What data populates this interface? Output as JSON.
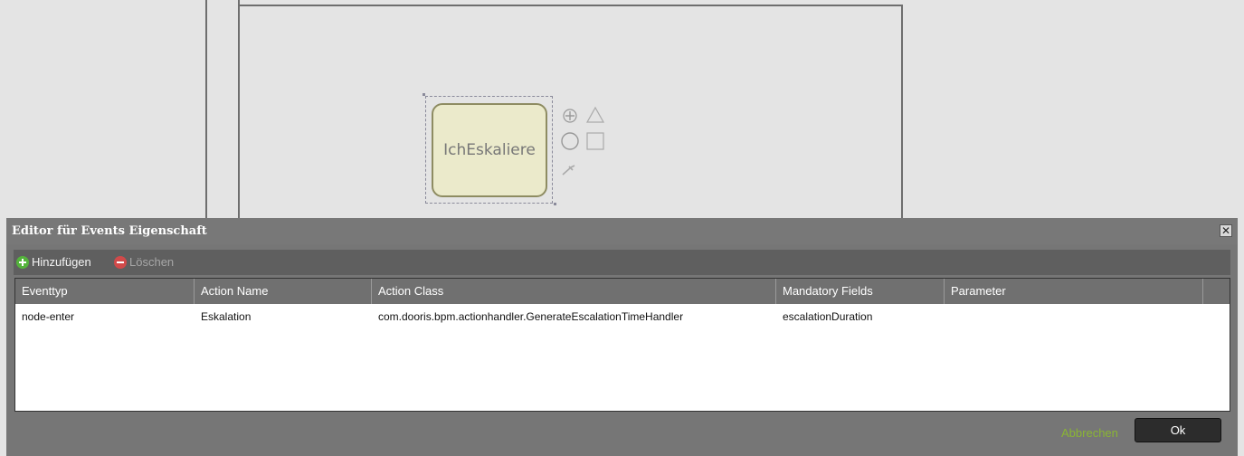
{
  "canvas": {
    "task_label": "IchEskaliere"
  },
  "dialog": {
    "title": "Editor für Events Eigenschaft",
    "close_symbol": "✕",
    "toolbar": {
      "add_label": "Hinzufügen",
      "delete_label": "Löschen"
    },
    "columns": [
      "Eventtyp",
      "Action Name",
      "Action Class",
      "Mandatory Fields",
      "Parameter"
    ],
    "rows": [
      {
        "eventtyp": "node-enter",
        "action_name": "Eskalation",
        "action_class": "com.dooris.bpm.actionhandler.GenerateEscalationTimeHandler",
        "mandatory_fields": "escalationDuration",
        "parameter": ""
      }
    ],
    "cancel_label": "Abbrechen",
    "ok_label": "Ok"
  },
  "colors": {
    "task_fill": "#ebeacb",
    "task_border": "#8e8c62",
    "dialog_bg": "#6e6e6e",
    "add_icon": "#54b33c",
    "delete_icon": "#d14a4a",
    "cancel_link": "#8ab534"
  },
  "icons": [
    "add-icon",
    "delete-icon",
    "close-icon",
    "move-icon",
    "triangle-icon",
    "circle-icon",
    "square-icon",
    "wrench-icon"
  ]
}
